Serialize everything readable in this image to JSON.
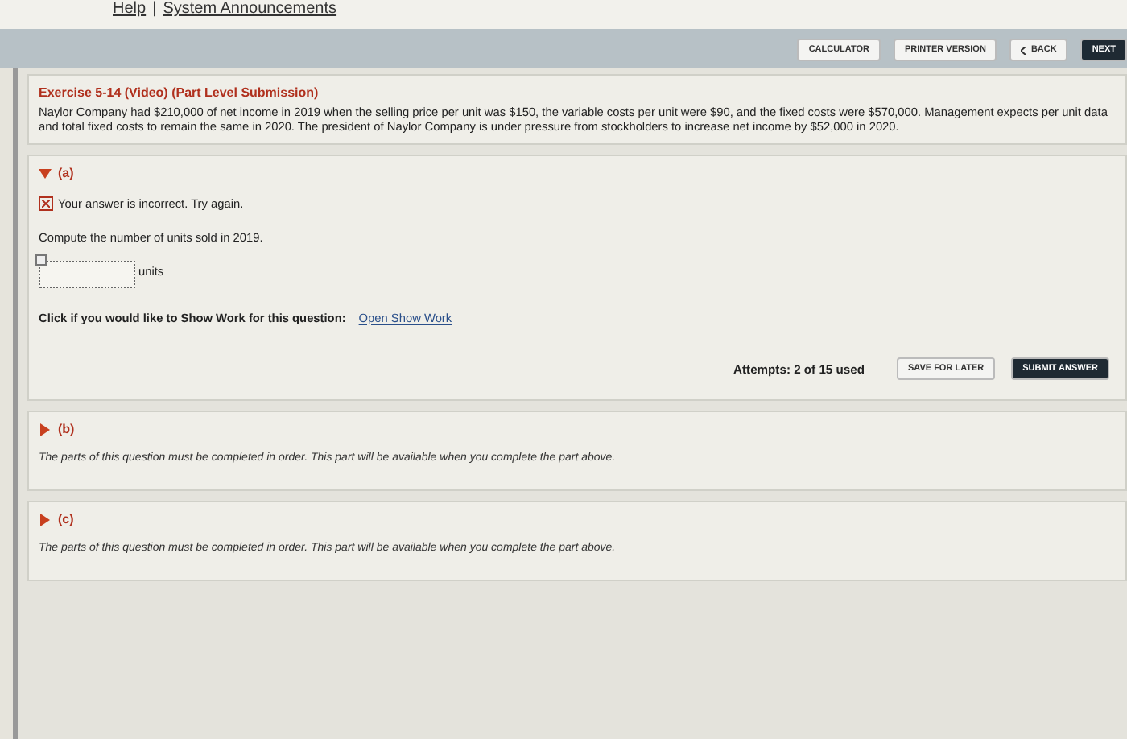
{
  "header": {
    "links": [
      "Help",
      "System Announcements"
    ],
    "separator": "|"
  },
  "toolbar": {
    "buttons": [
      {
        "label": "CALCULATOR",
        "kind": "plain"
      },
      {
        "label": "PRINTER VERSION",
        "kind": "plain"
      },
      {
        "label": "BACK",
        "kind": "back"
      },
      {
        "label": "NEXT",
        "kind": "dark"
      }
    ]
  },
  "exercise": {
    "title": "Exercise 5-14 (Video) (Part Level Submission)",
    "text": "Naylor Company had $210,000 of net income in 2019 when the selling price per unit was $150, the variable costs per unit were $90, and the fixed costs were $570,000. Management expects per unit data and total fixed costs to remain the same in 2020. The president of Naylor Company is under pressure from stockholders to increase net income by $52,000 in 2020."
  },
  "parts": [
    {
      "label": "(a)",
      "expanded": true,
      "feedback": "Your answer is incorrect.  Try again.",
      "question": "Compute the number of units sold in 2019.",
      "answer": {
        "unit": "units",
        "incorrect": true
      },
      "show_work": {
        "prompt": "Click if you would like to Show Work for this question:",
        "link": "Open Show Work"
      },
      "attempts": "Attempts: 2 of 15 used",
      "buttons": [
        {
          "label": "SAVE FOR LATER",
          "kind": "plain"
        },
        {
          "label": "SUBMIT ANSWER",
          "kind": "dark"
        }
      ]
    },
    {
      "label": "(b)",
      "expanded": false,
      "message": "The parts of this question must be completed in order. This part will be available when you complete the part above."
    },
    {
      "label": "(c)",
      "expanded": false,
      "message": "The parts of this question must be completed in order. This part will be available when you complete the part above."
    }
  ]
}
